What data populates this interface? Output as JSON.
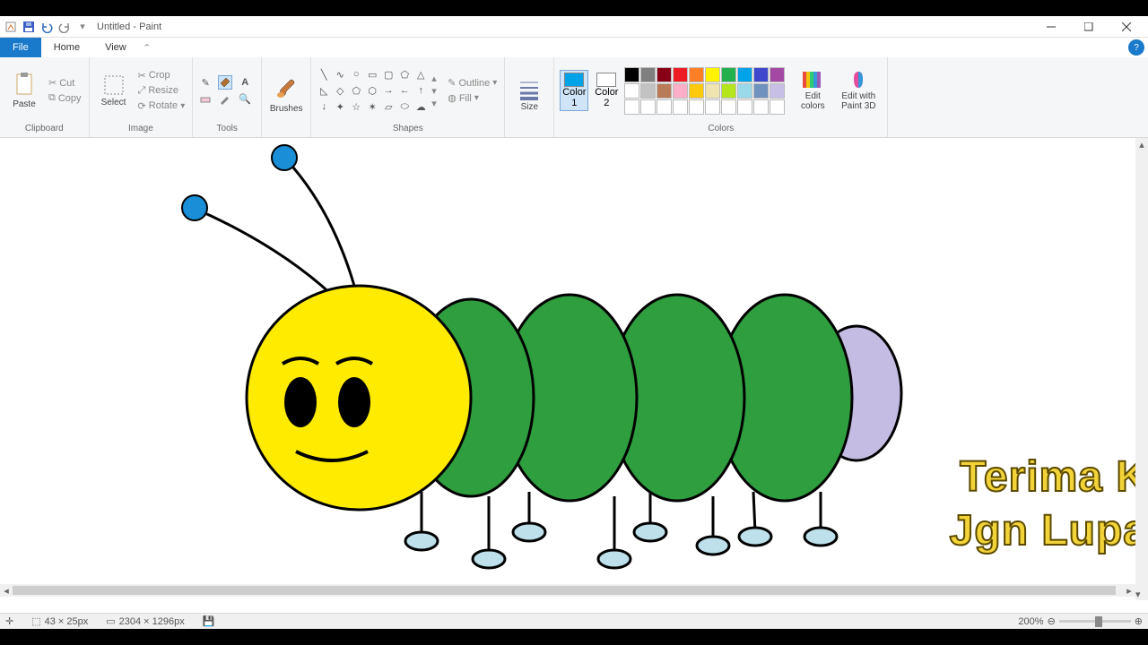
{
  "title": "Untitled - Paint",
  "tabs": {
    "file": "File",
    "home": "Home",
    "view": "View"
  },
  "clipboard": {
    "paste": "Paste",
    "cut": "Cut",
    "copy": "Copy",
    "label": "Clipboard"
  },
  "image": {
    "select": "Select",
    "crop": "Crop",
    "resize": "Resize",
    "rotate": "Rotate",
    "label": "Image"
  },
  "tools": {
    "label": "Tools"
  },
  "brushes": {
    "label": "Brushes"
  },
  "shapes": {
    "outline": "Outline",
    "fill": "Fill",
    "label": "Shapes"
  },
  "size": {
    "label": "Size"
  },
  "colors": {
    "color1": "Color\n1",
    "color2": "Color\n2",
    "edit": "Edit\ncolors",
    "edit3d": "Edit with\nPaint 3D",
    "label": "Colors",
    "row1": [
      "#000000",
      "#7f7f7f",
      "#880015",
      "#ed1c24",
      "#ff7f27",
      "#fff200",
      "#22b14c",
      "#00a2e8",
      "#3f48cc",
      "#a349a4"
    ],
    "row2": [
      "#ffffff",
      "#c3c3c3",
      "#b97a57",
      "#ffaec9",
      "#ffc90e",
      "#efe4b0",
      "#b5e61d",
      "#99d9ea",
      "#7092be",
      "#c8bfe7"
    ],
    "sel1": "#00a2e8",
    "sel2": "#ffffff"
  },
  "status": {
    "cursor": "43 × 25px",
    "canvas": "2304 × 1296px",
    "zoom": "200%"
  },
  "watermark": {
    "line1": "Terima K",
    "line2": "Jgn Lupa "
  }
}
